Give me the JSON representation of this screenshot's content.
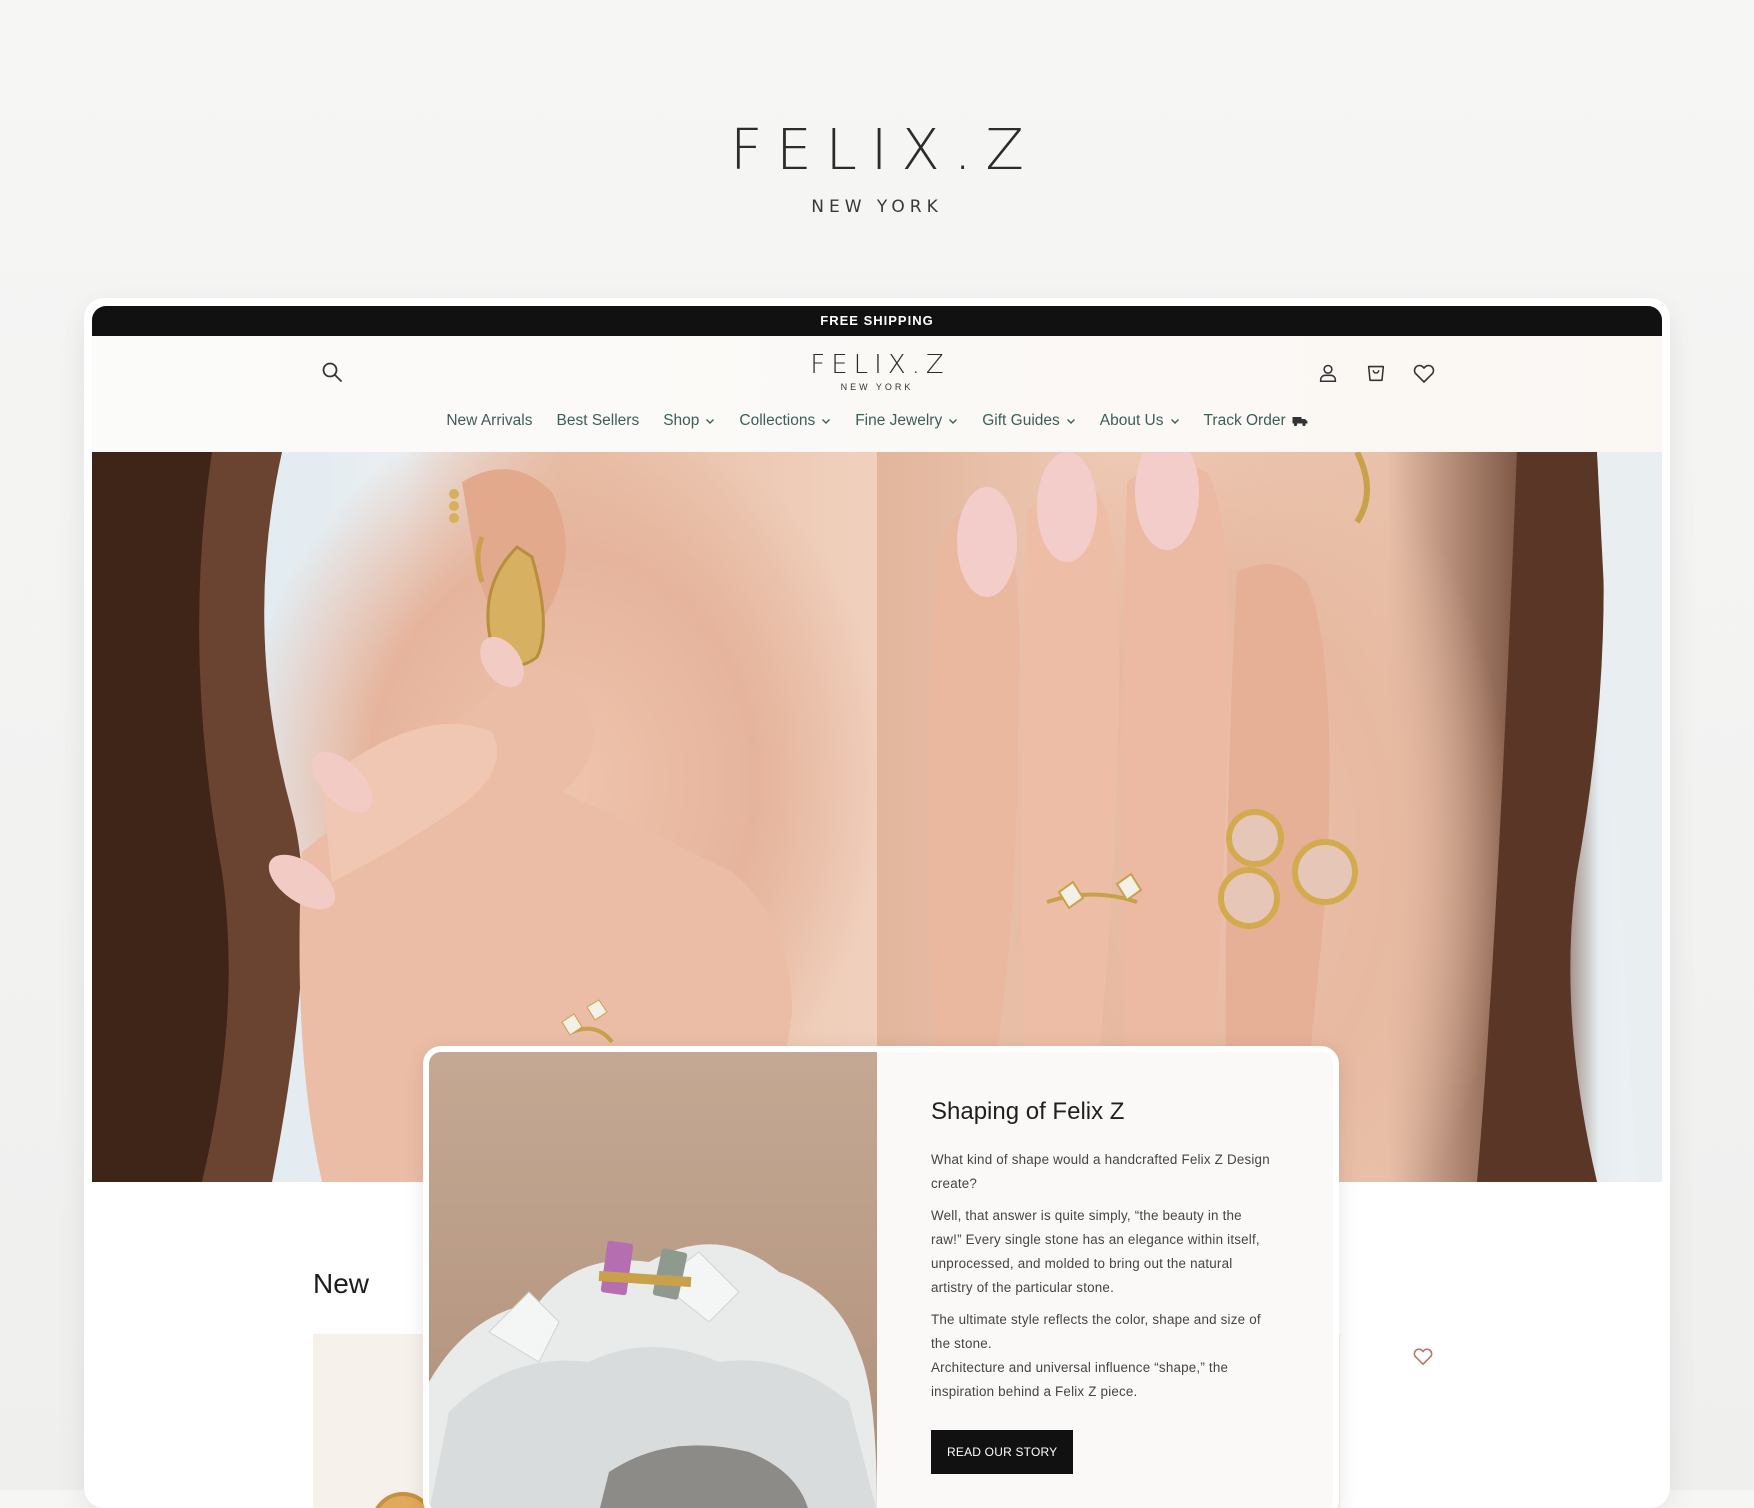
{
  "brand": {
    "name": "FELIX.Z",
    "sub": "NEW YORK"
  },
  "announcement": "FREE SHIPPING",
  "header": {
    "logo_name": "FELIX.Z",
    "logo_sub": "NEW YORK",
    "icons": [
      "search-icon",
      "account-icon",
      "cart-icon",
      "wishlist-heart-icon"
    ]
  },
  "nav": [
    {
      "label": "New Arrivals",
      "dropdown": false
    },
    {
      "label": "Best Sellers",
      "dropdown": false
    },
    {
      "label": "Shop",
      "dropdown": true
    },
    {
      "label": "Collections",
      "dropdown": true
    },
    {
      "label": "Fine Jewelry",
      "dropdown": true
    },
    {
      "label": "Gift Guides",
      "dropdown": true
    },
    {
      "label": "About Us",
      "dropdown": true
    },
    {
      "label": "Track Order",
      "dropdown": false,
      "icon": "truck-icon"
    }
  ],
  "card": {
    "title": "Shaping of Felix Z",
    "paragraphs": [
      "What kind of shape would a handcrafted Felix Z Design create?",
      "Well, that answer is quite simply, “the beauty in the raw!” Every single stone has an elegance within itself, unprocessed, and molded to bring out the natural artistry of the particular stone.",
      "The ultimate style reflects the color, shape and size of the stone.",
      "Architecture and universal influence “shape,” the inspiration behind a Felix Z piece."
    ],
    "button": "READ OUR STORY"
  },
  "section": {
    "new_title": "New"
  },
  "colors": {
    "nav_text": "#3b5e58",
    "announce_bg": "#111111",
    "button_bg": "#111111"
  }
}
